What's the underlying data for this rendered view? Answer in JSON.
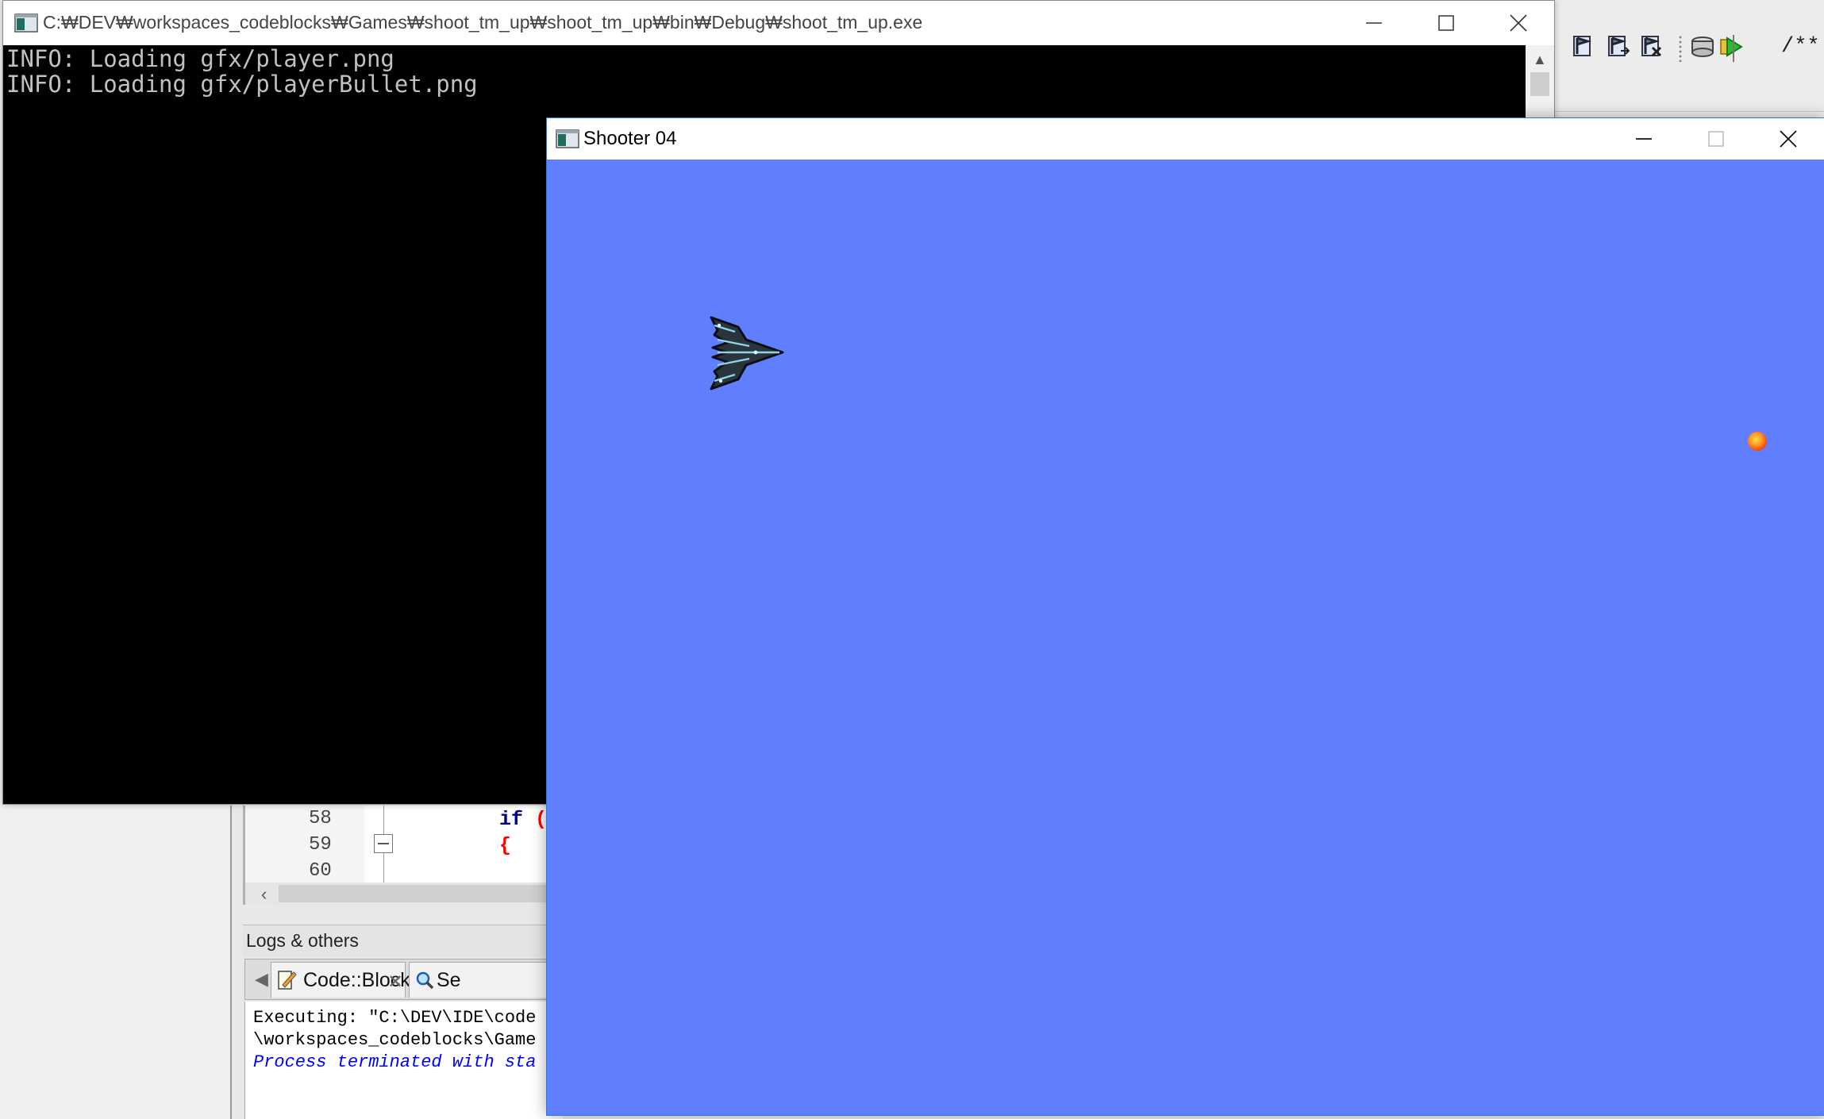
{
  "console_window": {
    "title": "C:₩DEV₩workspaces_codeblocks₩Games₩shoot_tm_up₩shoot_tm_up₩bin₩Debug₩shoot_tm_up.exe",
    "output_lines": [
      "INFO: Loading gfx/player.png",
      "INFO: Loading gfx/playerBullet.png"
    ]
  },
  "game_window": {
    "title": "Shooter 04",
    "background_color": "#5f7fff",
    "sprites": {
      "player": "player-ship",
      "bullet": "enemy-bullet"
    }
  },
  "ide": {
    "toolbar": {
      "icons": [
        "bookmark-toggle-icon",
        "bookmark-next-icon",
        "bookmark-clear-icon",
        "stack-icon",
        "run-icon"
      ],
      "comment_button": "/**"
    },
    "editor": {
      "lines": [
        {
          "number": "58",
          "code": "if (",
          "tokens": [
            {
              "text": "if",
              "color": "#00008b"
            },
            {
              "text": " (",
              "color": "#ff0000"
            }
          ]
        },
        {
          "number": "59",
          "code": "{",
          "tokens": [
            {
              "text": "{",
              "color": "#ff0000"
            }
          ]
        },
        {
          "number": "60",
          "code": "",
          "tokens": []
        }
      ]
    },
    "logs_panel": {
      "header": "Logs & others",
      "tabs": [
        {
          "label": "Code::Blocks",
          "icon": "note-icon"
        },
        {
          "label": "Se",
          "icon": "search-icon"
        }
      ],
      "lines": [
        {
          "text": "Executing: \"C:\\DEV\\IDE\\code",
          "color": "#000000",
          "italic": false
        },
        {
          "text": "\\workspaces_codeblocks\\Game",
          "color": "#000000",
          "italic": false
        },
        {
          "text": "Process terminated with sta",
          "color": "#0000ff",
          "italic": true
        }
      ]
    }
  }
}
